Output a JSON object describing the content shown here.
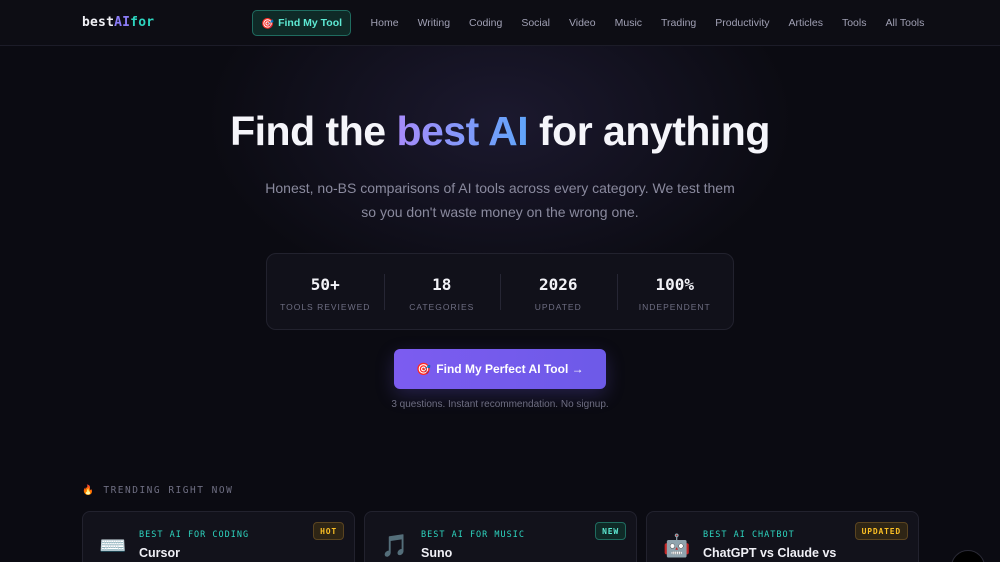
{
  "nav": {
    "logo_part1": "best",
    "logo_part2": "AI",
    "logo_part3": "for",
    "cta_icon": "🎯",
    "cta_label": "Find My Tool",
    "links": [
      "Home",
      "Writing",
      "Coding",
      "Social",
      "Video",
      "Music",
      "Trading",
      "Productivity",
      "Articles",
      "Tools",
      "All Tools"
    ]
  },
  "hero": {
    "title_before": "Find the ",
    "title_accent": "best AI",
    "title_after": " for anything",
    "subtitle": "Honest, no-BS comparisons of AI tools across every category. We test them so you don't waste money on the wrong one."
  },
  "stats": [
    {
      "value": "50+",
      "label": "TOOLS REVIEWED"
    },
    {
      "value": "18",
      "label": "CATEGORIES"
    },
    {
      "value": "2026",
      "label": "UPDATED"
    },
    {
      "value": "100%",
      "label": "INDEPENDENT"
    }
  ],
  "cta": {
    "icon": "🎯",
    "label": "Find My Perfect AI Tool →",
    "note": "3 questions. Instant recommendation. No signup."
  },
  "trending": {
    "icon": "🔥",
    "label": "TRENDING RIGHT NOW",
    "cards": [
      {
        "icon": "⌨️",
        "icon_name": "keyboard-icon",
        "kicker": "BEST AI FOR CODING",
        "title": "Cursor",
        "badge": "HOT"
      },
      {
        "icon": "🎵",
        "icon_name": "music-note-icon",
        "kicker": "BEST AI FOR MUSIC",
        "title": "Suno",
        "badge": "NEW"
      },
      {
        "icon": "🤖",
        "icon_name": "robot-icon",
        "kicker": "BEST AI CHATBOT",
        "title": "ChatGPT vs Claude vs",
        "badge": "UPDATED"
      }
    ]
  },
  "colors": {
    "background": "#0b0b12",
    "accent_purple": "#7c5cf0",
    "accent_teal": "#2dd4bf",
    "badge_amber": "#fbbf24"
  }
}
